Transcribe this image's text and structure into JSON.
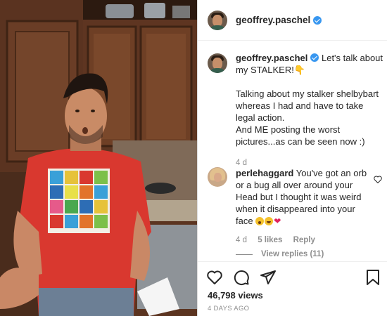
{
  "post": {
    "username": "geoffrey.paschel",
    "verified": true,
    "caption_intro": "Let's talk about my STALKER!👇",
    "caption_body": "Talking about my stalker shelbybart whereas I had and have to take legal action.",
    "caption_body2": "And ME posting the worst pictures...as can be seen now :)",
    "caption_age": "4 d",
    "views": "46,798 views",
    "posted": "4 DAYS AGO"
  },
  "comment": {
    "username": "perlehaggard",
    "text": "You've got an orb or a bug all over around your Head but I thought it was weird when it disappeared into your face",
    "emojis": [
      "astonished-face",
      "laughing-face",
      "red-heart"
    ],
    "age": "4 d",
    "likes": "5 likes",
    "reply": "Reply",
    "view_replies": "View replies (11)"
  },
  "icons": {
    "like": "heart-icon",
    "comment": "comment-icon",
    "share": "paper-plane-icon",
    "save": "bookmark-icon"
  },
  "colors": {
    "verified": "#3897f0",
    "secondary_text": "#8e8e8e",
    "shirt": "#d9382f"
  }
}
